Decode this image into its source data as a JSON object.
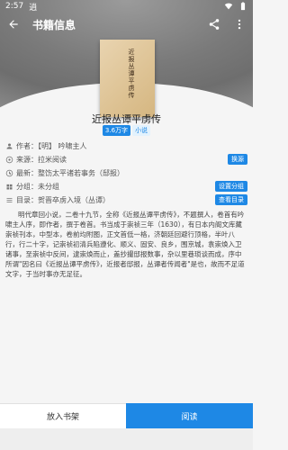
{
  "status_bar": {
    "time": "2:57",
    "app_tag": "逍"
  },
  "topbar": {
    "title": "书籍信息"
  },
  "book": {
    "cover_title": "近报丛谭平虏传",
    "title": "近报丛谭平虏传",
    "wordcount": "3.6万字",
    "type": "小说"
  },
  "info": {
    "author": "作者：【明】 吟啸主人",
    "source": "来源：拉米阅读",
    "source_action": "换源",
    "latest": "最新：整饬太平诸若事务（邸报）",
    "group": "分组：未分组",
    "group_action": "设置分组",
    "toc": "目录：贺晋卒虏入境（丛谭）",
    "toc_action": "查看目录"
  },
  "description": "明代章回小说，二卷十九节，全称《近报丛谭平虏传》，不题撰人，卷首有吟啸主人序，即作者，撰于卷首。书当成于崇祯三年（1630），有日本内阁文库藏崇祯刊本，中型本，卷前均附图，正文首低一格，济朝廷回避行顶格，半叶八行，行二十字，记崇祯初清兵陷遵化、顺义、固安、良乡，围京城，袁崇焕入卫诸事，至崇祯中反间，逮崇焕而止，盖抄撮邸报数事，杂以里巷琐谈而成，序中所谓\"因名曰《近报丛谭平虏传》，近报者邸报，丛谭者传闻者\"是也，故而不足道文字，于当时事亦无足征。",
  "bottom": {
    "shelf_label": "放入书架",
    "read_label": "阅读"
  }
}
